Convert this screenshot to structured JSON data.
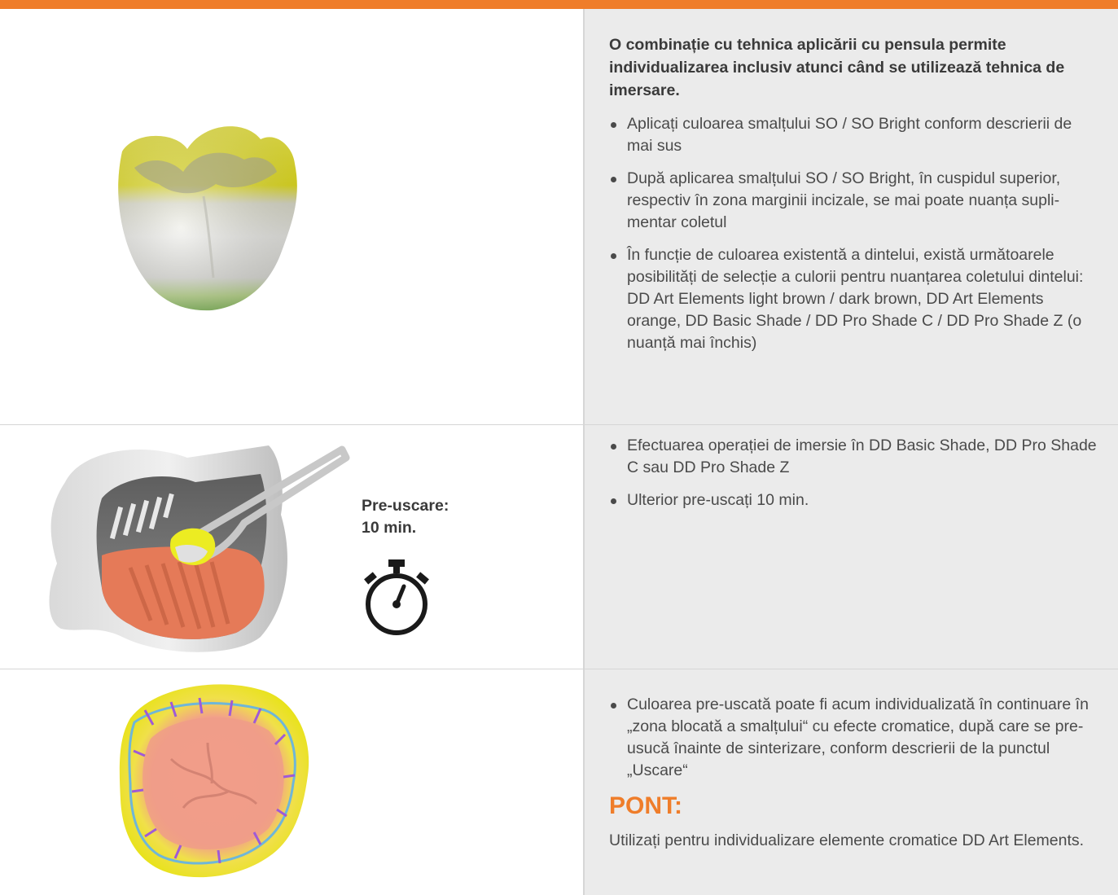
{
  "colors": {
    "accent": "#ef7d2a",
    "panel_bg": "#ebebeb",
    "divider": "#d6d6d6"
  },
  "rows": [
    {
      "image_icon": "tooth-crown-image",
      "intro": "O combinație cu tehnica aplicării cu pensula permite individualizarea inclusiv atunci când se utilizează tehnica de imersare.",
      "bullets": [
        "Aplicați culoarea smalțului SO / SO Bright conform descrierii de mai sus",
        "După aplicarea smalțului SO / SO Bright, în cuspidul superior, respectiv în zona marginii incizale, se mai poate nuanța supli- mentar coletul",
        "În funcție de culoarea existentă a dintelui, există următoarele posibilități de selecție a culorii pentru nuanțarea coletului dintelui: DD Art Elements light brown / dark brown, DD Art Elements orange, DD Basic Shade / DD Pro Shade C / DD Pro Shade Z (o nuanță mai închis)"
      ]
    },
    {
      "image_icon": "dipping-container-image",
      "predry_label": "Pre-uscare:",
      "predry_time": "10 min.",
      "timer_icon": "stopwatch-icon",
      "bullets": [
        "Efectuarea operației de imersie în DD Basic Shade, DD Pro Shade C sau DD Pro Shade Z",
        "Ulterior pre-uscați 10 min."
      ]
    },
    {
      "image_icon": "tooth-occlusal-image",
      "bullets": [
        "Culoarea pre-uscată poate fi acum individualizată în continuare în „zona blocată a smalțului“ cu efecte cromatice, după care se pre-usucă înainte de sinterizare, conform descrierii de la punctul „Uscare“"
      ],
      "tip_title": "PONT:",
      "tip_text": "Utilizați pentru individualizare elemente cromatice DD Art Elements."
    }
  ]
}
